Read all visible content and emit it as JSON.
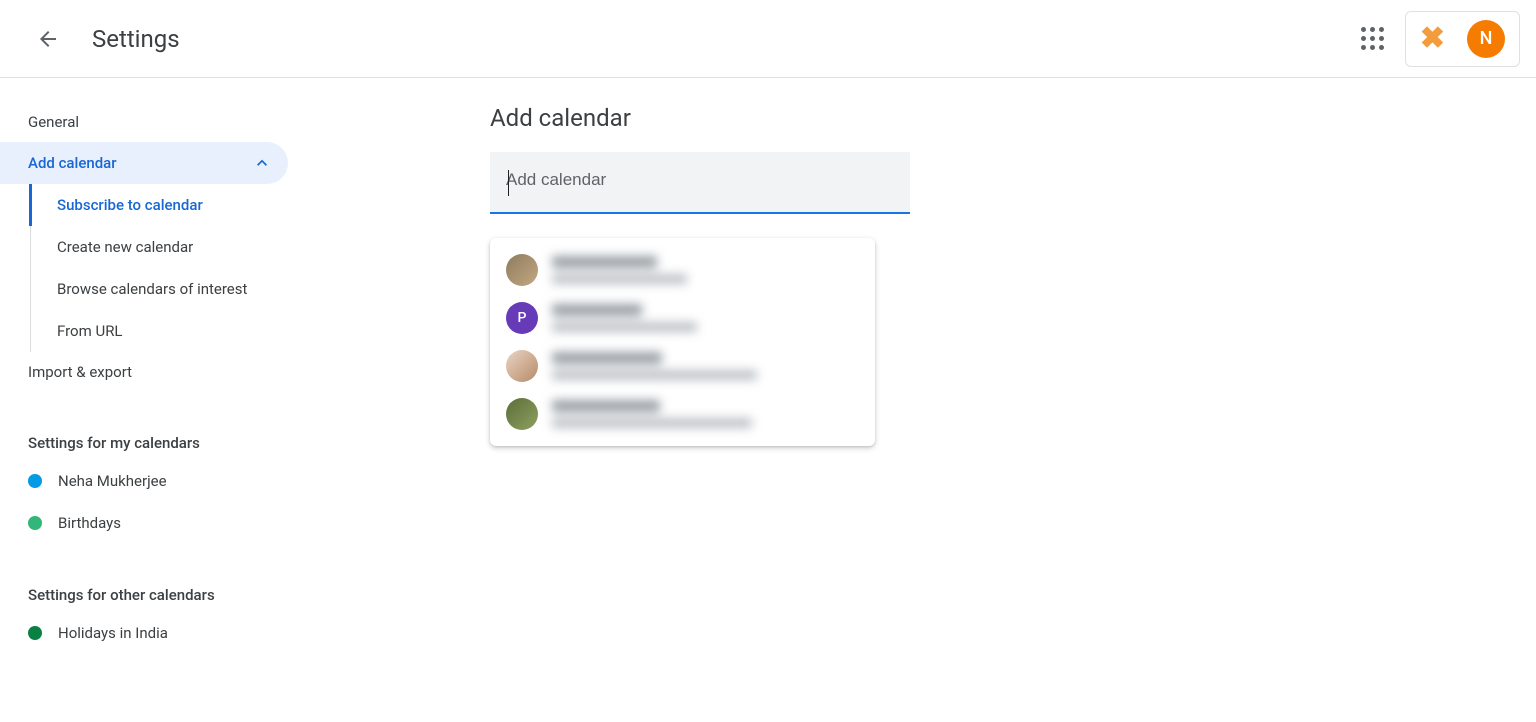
{
  "header": {
    "title": "Settings",
    "avatarInitial": "N"
  },
  "sidebar": {
    "general": "General",
    "addCalendar": "Add calendar",
    "subItems": {
      "subscribe": "Subscribe to calendar",
      "createNew": "Create new calendar",
      "browse": "Browse calendars of interest",
      "fromUrl": "From URL"
    },
    "importExport": "Import & export",
    "myCalendarsHeading": "Settings for my calendars",
    "myCalendars": [
      {
        "label": "Neha Mukherjee",
        "color": "#039be5"
      },
      {
        "label": "Birthdays",
        "color": "#33b679"
      }
    ],
    "otherCalendarsHeading": "Settings for other calendars",
    "otherCalendars": [
      {
        "label": "Holidays in India",
        "color": "#0b8043"
      }
    ]
  },
  "main": {
    "title": "Add calendar",
    "placeholder": "Add calendar",
    "suggestions": [
      {
        "avatarBg": "linear-gradient(135deg,#8d7b5e,#c4a882)",
        "nameWidth": "105px",
        "emailWidth": "135px",
        "initial": ""
      },
      {
        "avatarBg": "#673ab7",
        "nameWidth": "90px",
        "emailWidth": "145px",
        "initial": "P"
      },
      {
        "avatarBg": "linear-gradient(135deg,#e8d5c4,#b88968)",
        "nameWidth": "110px",
        "emailWidth": "205px",
        "initial": ""
      },
      {
        "avatarBg": "linear-gradient(135deg,#5a6e3a,#8fa05e)",
        "nameWidth": "108px",
        "emailWidth": "200px",
        "initial": ""
      }
    ]
  }
}
